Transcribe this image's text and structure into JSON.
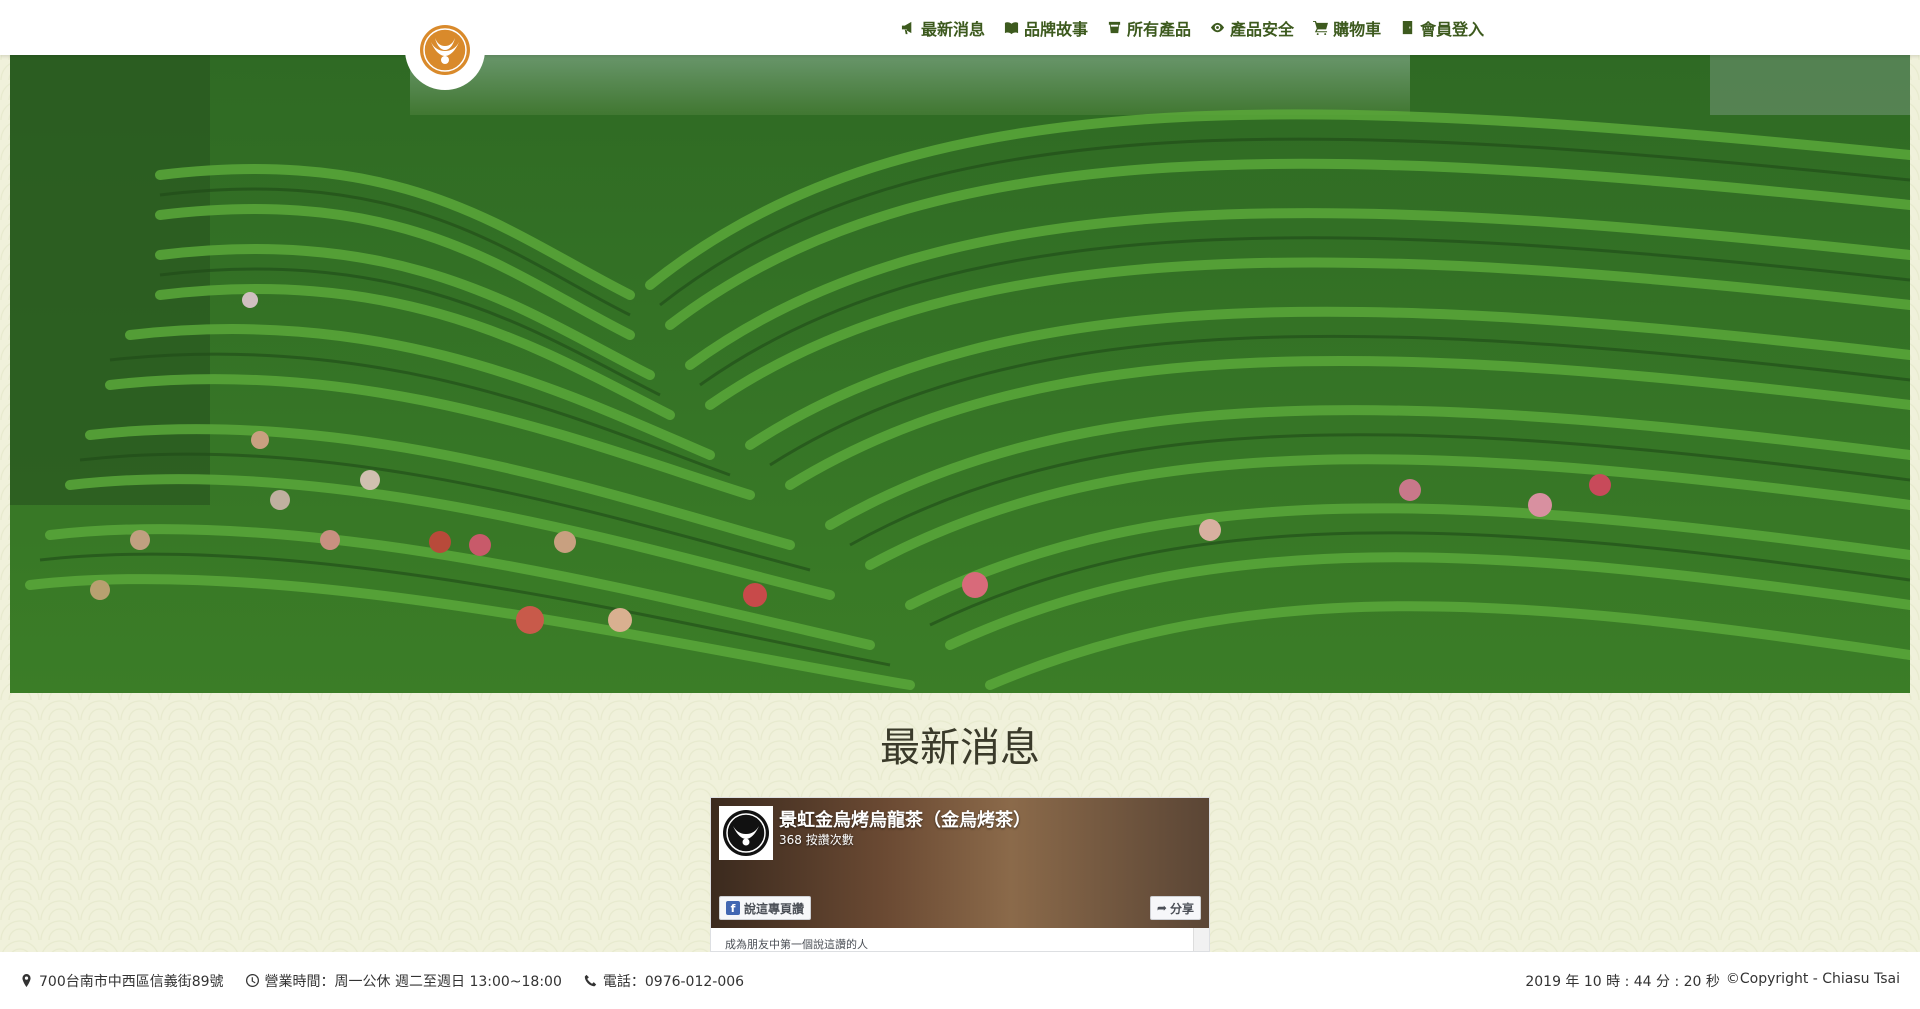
{
  "header": {
    "logo_icon": "crescent-bird-logo",
    "nav": [
      {
        "label": "最新消息",
        "icon": "bullhorn-icon"
      },
      {
        "label": "品牌故事",
        "icon": "book-icon"
      },
      {
        "label": "所有產品",
        "icon": "cup-icon"
      },
      {
        "label": "產品安全",
        "icon": "eye-icon"
      },
      {
        "label": "購物車",
        "icon": "cart-icon"
      },
      {
        "label": "會員登入",
        "icon": "door-icon"
      }
    ]
  },
  "hero": {
    "image": "tea-plantation-hillside"
  },
  "news": {
    "title": "最新消息",
    "fb_page": {
      "name": "景虹金烏烤烏龍茶（金烏烤茶）",
      "likes": "368 按讚次數",
      "like_button": "說這專頁讚",
      "share_button": "分享",
      "friends_text": "成為朋友中第一個說這讚的人"
    }
  },
  "footer": {
    "address": "700台南市中西區信義街89號",
    "hours": "營業時間：周一公休 週二至週日 13:00~18:00",
    "phone": "電話：0976-012-006",
    "clock": "2019 年 10 時 : 44 分 : 20 秒",
    "copyright": "©Copyright - Chiasu Tsai"
  },
  "colors": {
    "nav_text": "#3d5a1e",
    "logo": "#d4892a",
    "background": "#f0f1db"
  }
}
